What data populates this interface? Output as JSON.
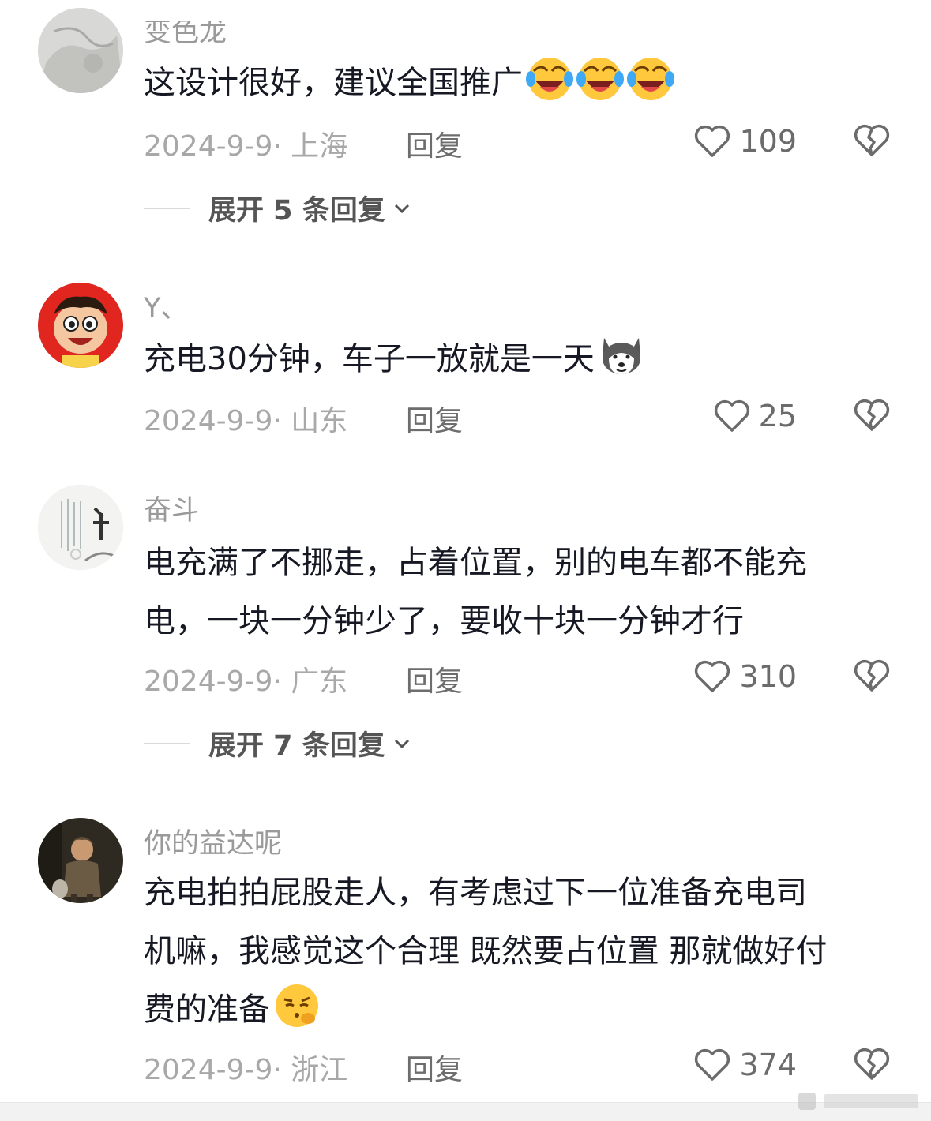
{
  "comments": [
    {
      "username": "变色龙",
      "text": "这设计很好，建议全国推广",
      "date": "2024-9-9",
      "location": "上海",
      "reply_label": "回复",
      "likes": "109",
      "expand_label": "展开 5 条回复",
      "emoji": "laugh-cry-emoji",
      "avatar": "gray-sketch-avatar"
    },
    {
      "username": "Y、",
      "text": "充电30分钟，车子一放就是一天",
      "date": "2024-9-9",
      "location": "山东",
      "reply_label": "回复",
      "likes": "25",
      "emoji": "husky-dog-emoji",
      "avatar": "cartoon-boy-avatar"
    },
    {
      "username": "奋斗",
      "text_lines": [
        "电充满了不挪走，占着位置，别的电车都不能充",
        "电，一块一分钟少了，要收十块一分钟才行"
      ],
      "date": "2024-9-9",
      "location": "广东",
      "reply_label": "回复",
      "likes": "310",
      "expand_label": "展开 7 条回复",
      "avatar": "calligraphy-avatar"
    },
    {
      "username": "你的益达呢",
      "text_lines": [
        "充电拍拍屁股走人，有考虑过下一位准备充电司",
        "机嘛，我感觉这个合理 既然要占位置 那就做好付",
        "费的准备"
      ],
      "date": "2024-9-9",
      "location": "浙江",
      "reply_label": "回复",
      "likes": "374",
      "emoji": "thinking-face-emoji",
      "avatar": "boy-portrait-avatar"
    }
  ],
  "colors": {
    "text": "#161823",
    "meta": "#a8a8a8",
    "username": "#9a9a9a"
  },
  "meta_separator": "· "
}
